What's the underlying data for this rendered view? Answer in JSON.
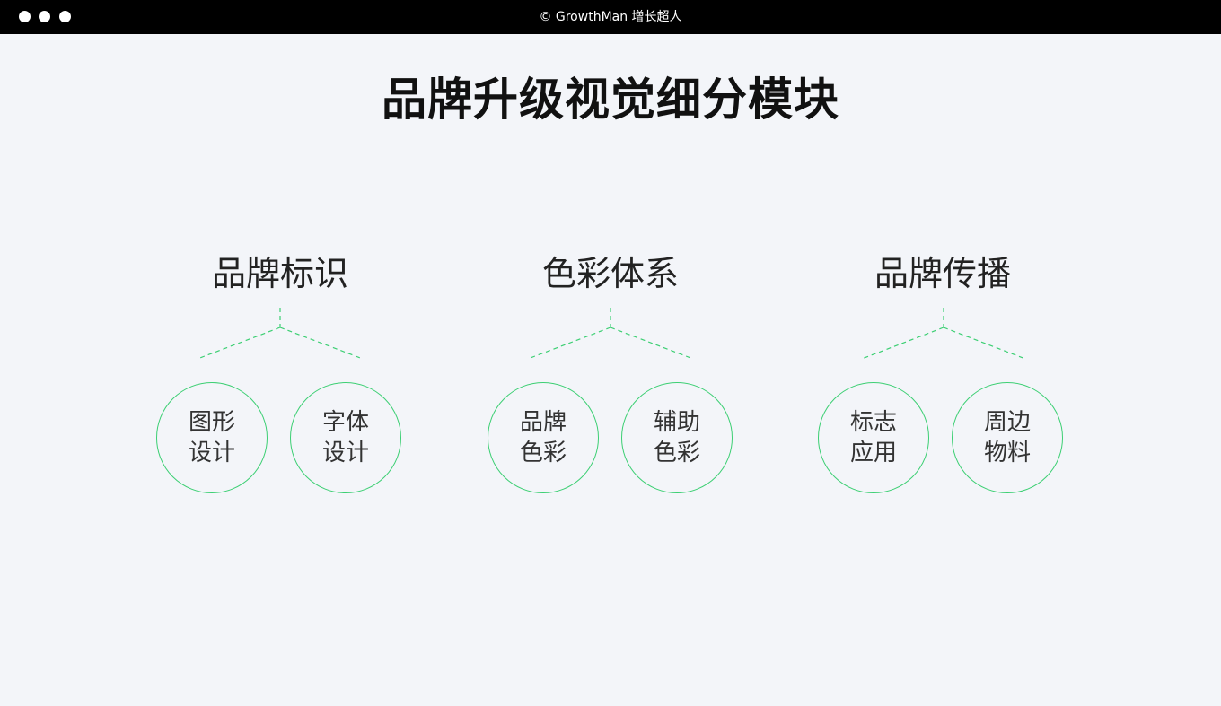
{
  "window": {
    "copyright": "© GrowthMan 增长超人"
  },
  "page": {
    "title": "品牌升级视觉细分模块"
  },
  "colors": {
    "background": "#f3f5f9",
    "titlebar": "#000000",
    "accent_green": "#3ccf73",
    "text_dark": "#111111"
  },
  "modules": [
    {
      "title": "品牌标识",
      "items": [
        {
          "label": "图形设计"
        },
        {
          "label": "字体设计"
        }
      ]
    },
    {
      "title": "色彩体系",
      "items": [
        {
          "label": "品牌色彩"
        },
        {
          "label": "辅助色彩"
        }
      ]
    },
    {
      "title": "品牌传播",
      "items": [
        {
          "label": "标志应用"
        },
        {
          "label": "周边物料"
        }
      ]
    }
  ]
}
